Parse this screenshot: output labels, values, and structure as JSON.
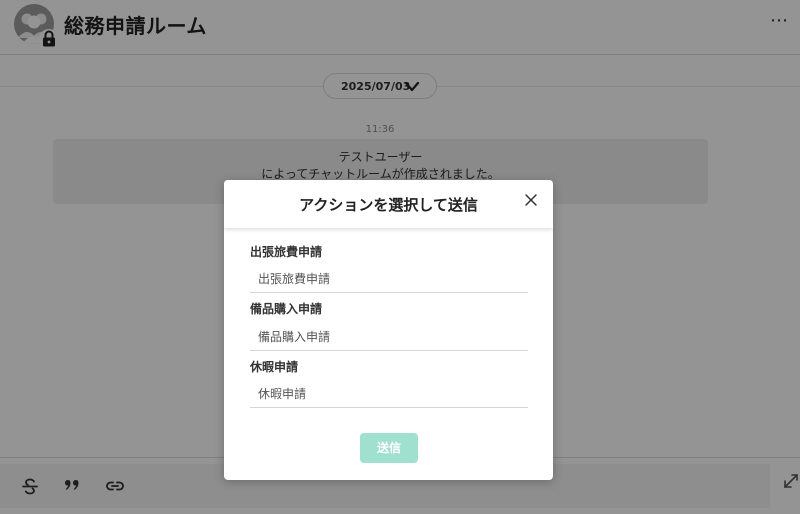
{
  "header": {
    "title": "総務申請ルーム",
    "more_label": "⋯"
  },
  "timeline": {
    "date": "2025/07/03",
    "time": "11:36",
    "system_message": {
      "line1": "テストユーザー",
      "line2": "によってチャットルームが作成されました。"
    }
  },
  "modal": {
    "title": "アクションを選択して送信",
    "fields": [
      {
        "label": "出張旅費申請",
        "placeholder": "出張旅費申請"
      },
      {
        "label": "備品購入申請",
        "placeholder": "備品購入申請"
      },
      {
        "label": "休暇申請",
        "placeholder": "休暇申請"
      }
    ],
    "send_label": "送信"
  },
  "composer": {
    "tools": [
      "strikethrough-icon",
      "quote-icon",
      "link-icon"
    ]
  },
  "colors": {
    "accent_disabled": "#a0e0cf",
    "overlay": "rgba(0,0,0,0.42)"
  }
}
